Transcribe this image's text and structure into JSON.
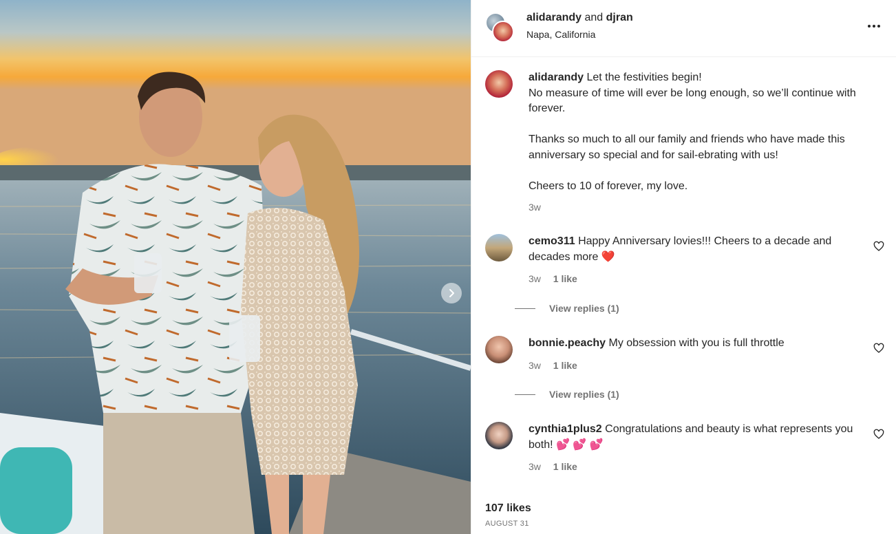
{
  "header": {
    "user_primary": "alidarandy",
    "joiner": "and",
    "user_secondary": "djran",
    "location": "Napa, California",
    "more_icon": "more-horizontal-icon"
  },
  "caption": {
    "username": "alidarandy",
    "text": "Let the festivities begin!\nNo measure of time will ever be long enough, so we’ll continue with forever.\n\nThanks so much to all our family and friends who have made this anniversary so special and for sail-ebrating with us!\n\nCheers to 10 of forever, my love.",
    "time": "3w"
  },
  "comments": [
    {
      "username": "cemo311",
      "text": "Happy Anniversary lovies!!! Cheers to a decade and decades more",
      "emoji": "❤️",
      "time": "3w",
      "likes": "1 like",
      "view_replies": "View replies (1)"
    },
    {
      "username": "bonnie.peachy",
      "text": "My obsession with you is full throttle",
      "emoji": "",
      "time": "3w",
      "likes": "1 like",
      "view_replies": "View replies (1)"
    },
    {
      "username": "cynthia1plus2",
      "text": "Congratulations and beauty is what represents you both!",
      "emoji": "💕 💕 💕",
      "time": "3w",
      "likes": "1 like"
    }
  ],
  "footer": {
    "likes": "107 likes",
    "date": "AUGUST 31"
  },
  "colors": {
    "text": "#262626",
    "secondary": "#737373",
    "border": "#efefef"
  }
}
